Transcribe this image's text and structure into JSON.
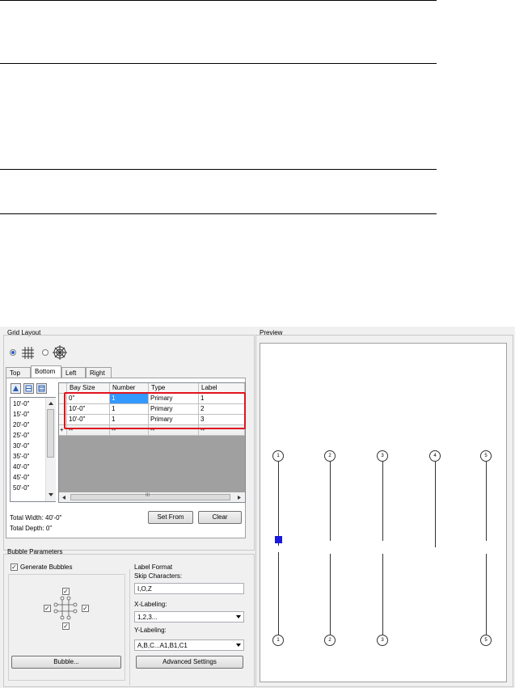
{
  "grid_layout": {
    "title": "Grid Layout",
    "tabs": [
      "Top",
      "Bottom",
      "Left",
      "Right"
    ],
    "bay_size_list": [
      "10'-0\"",
      "15'-0\"",
      "20'-0\"",
      "25'-0\"",
      "30'-0\"",
      "35'-0\"",
      "40'-0\"",
      "45'-0\"",
      "50'-0\""
    ],
    "table": {
      "headers": [
        "Bay Size",
        "Number",
        "Type",
        "Label"
      ],
      "rows": [
        [
          "0\"",
          "1",
          "Primary",
          "1"
        ],
        [
          "10'-0\"",
          "1",
          "Primary",
          "2"
        ],
        [
          "10'-0\"",
          "1",
          "Primary",
          "3"
        ]
      ],
      "new_row": [
        "--",
        "--",
        "--",
        "--"
      ],
      "new_row_marker": "+"
    },
    "scroll_glyph": "III",
    "total_width": "Total Width: 40'-0\"",
    "total_depth": "Total Depth: 0\"",
    "set_from_label": "Set From",
    "clear_label": "Clear"
  },
  "bubble_parameters": {
    "title": "Bubble Parameters",
    "generate_bubbles_label": "Generate Bubbles",
    "bubble_button_label": "Bubble...",
    "label_format_title": "Label Format",
    "skip_characters_label": "Skip Characters:",
    "skip_characters_value": "I,O,Z",
    "x_labeling_label": "X-Labeling:",
    "x_labeling_value": "1,2,3...",
    "y_labeling_label": "Y-Labeling:",
    "y_labeling_value": "A,B,C...A1,B1,C1",
    "advanced_settings_label": "Advanced Settings"
  },
  "preview": {
    "title": "Preview",
    "top_bubbles": [
      "1",
      "2",
      "3",
      "4",
      "5"
    ],
    "bottom_bubbles": [
      "1",
      "2",
      "3",
      "5"
    ]
  },
  "colors": {
    "highlight": "#e0141e",
    "selection": "#3399ff",
    "marker": "#1a1adc"
  }
}
